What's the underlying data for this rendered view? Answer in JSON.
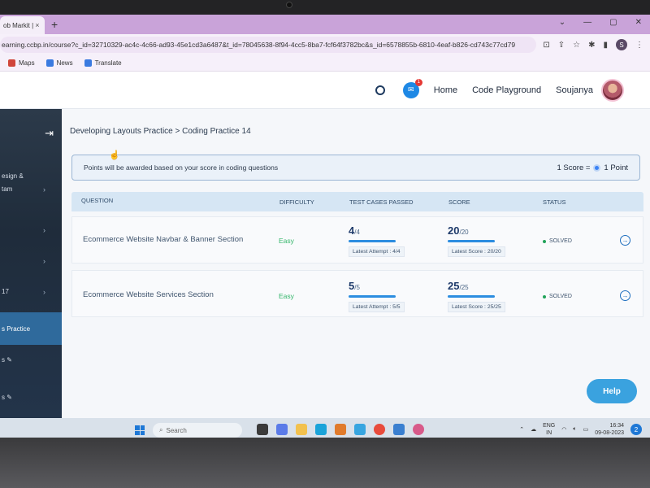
{
  "browser": {
    "tab_title": "ob Markit |",
    "tab_close": "×",
    "new_tab": "+",
    "window_controls": [
      "⌄",
      "—",
      "▢",
      "✕"
    ],
    "url": "earning.ccbp.in/course?c_id=32710329-ac4c-4c66-ad93-45e1cd3a6487&t_id=78045638-8f94-4cc5-8ba7-fcf64f3782bc&s_id=6578855b-6810-4eaf-b826-cd743c77cd79",
    "profile_initial": "S",
    "bookmarks": [
      {
        "label": "Maps",
        "color": "#d0463b"
      },
      {
        "label": "News",
        "color": "#3b7be0"
      },
      {
        "label": "Translate",
        "color": "#3b7be0"
      }
    ]
  },
  "header": {
    "chat_badge": "1",
    "nav_home": "Home",
    "nav_playground": "Code Playground",
    "user_name": "Soujanya"
  },
  "sidebar": {
    "collapse_icon": "⇥",
    "items": [
      {
        "label": "esign &"
      },
      {
        "label": "tam"
      },
      {
        "label": ""
      },
      {
        "label": ""
      },
      {
        "label": "17"
      }
    ],
    "active_label": "s Practice",
    "extra_items": [
      "s ✎",
      "s ✎"
    ]
  },
  "main": {
    "breadcrumb": "Developing Layouts Practice > Coding Practice 14",
    "notice": "Points will be awarded based on your score in coding questions",
    "score_rule_left": "1 Score =",
    "score_rule_right": "1 Point",
    "columns": {
      "question": "QUESTION",
      "difficulty": "DIFFICULTY",
      "test_cases": "TEST CASES PASSED",
      "score": "SCORE",
      "status": "STATUS"
    },
    "rows": [
      {
        "title": "Ecommerce Website Navbar & Banner Section",
        "difficulty": "Easy",
        "tests_passed": "4",
        "tests_total": "/4",
        "latest_attempt": "Latest Attempt : 4/4",
        "score": "20",
        "score_total": "/20",
        "latest_score": "Latest Score : 20/20",
        "status": "SOLVED"
      },
      {
        "title": "Ecommerce Website Services Section",
        "difficulty": "Easy",
        "tests_passed": "5",
        "tests_total": "/5",
        "latest_attempt": "Latest Attempt : 5/5",
        "score": "25",
        "score_total": "/25",
        "latest_score": "Latest Score : 25/25",
        "status": "SOLVED"
      }
    ],
    "help_label": "Help"
  },
  "taskbar": {
    "search_placeholder": "Search",
    "lang_top": "ENG",
    "lang_bottom": "IN",
    "time": "16:34",
    "date": "09-08-2023",
    "notification_count": "2"
  }
}
